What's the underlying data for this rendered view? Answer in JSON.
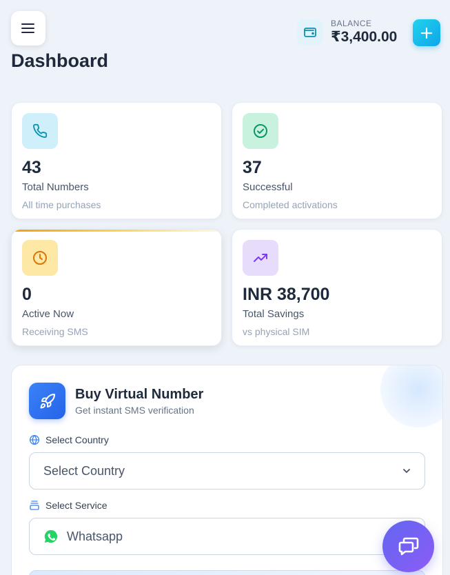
{
  "header": {
    "menu_icon": "hamburger-menu-icon",
    "balance_label": "BALANCE",
    "balance_value": "₹3,400.00",
    "add_icon": "plus-icon",
    "wallet_icon": "wallet-icon"
  },
  "page": {
    "title": "Dashboard"
  },
  "stats": [
    {
      "value": "43",
      "label": "Total Numbers",
      "sub": "All time purchases",
      "icon": "phone-icon",
      "icon_bg": "#cff0fa",
      "icon_color": "#0891b2"
    },
    {
      "value": "37",
      "label": "Successful",
      "sub": "Completed activations",
      "icon": "check-circle-icon",
      "icon_bg": "#c9f2de",
      "icon_color": "#059669"
    },
    {
      "value": "0",
      "label": "Active Now",
      "sub": "Receiving SMS",
      "icon": "clock-icon",
      "icon_bg": "#fde8a6",
      "icon_color": "#d97706"
    },
    {
      "value": "INR 38,700",
      "label": "Total Savings",
      "sub": "vs physical SIM",
      "icon": "trending-up-icon",
      "icon_bg": "#e7ddfb",
      "icon_color": "#7c3aed"
    }
  ],
  "buy": {
    "title": "Buy Virtual Number",
    "subtitle": "Get instant SMS verification",
    "country_label": "Select Country",
    "country_value": "Select Country",
    "service_label": "Select Service",
    "service_value": "Whatsapp",
    "service_icon": "whatsapp-icon"
  },
  "colors": {
    "accent_blue": "#2563eb",
    "accent_cyan": "#0ea5e9",
    "fab_purple": "#6366f1"
  }
}
